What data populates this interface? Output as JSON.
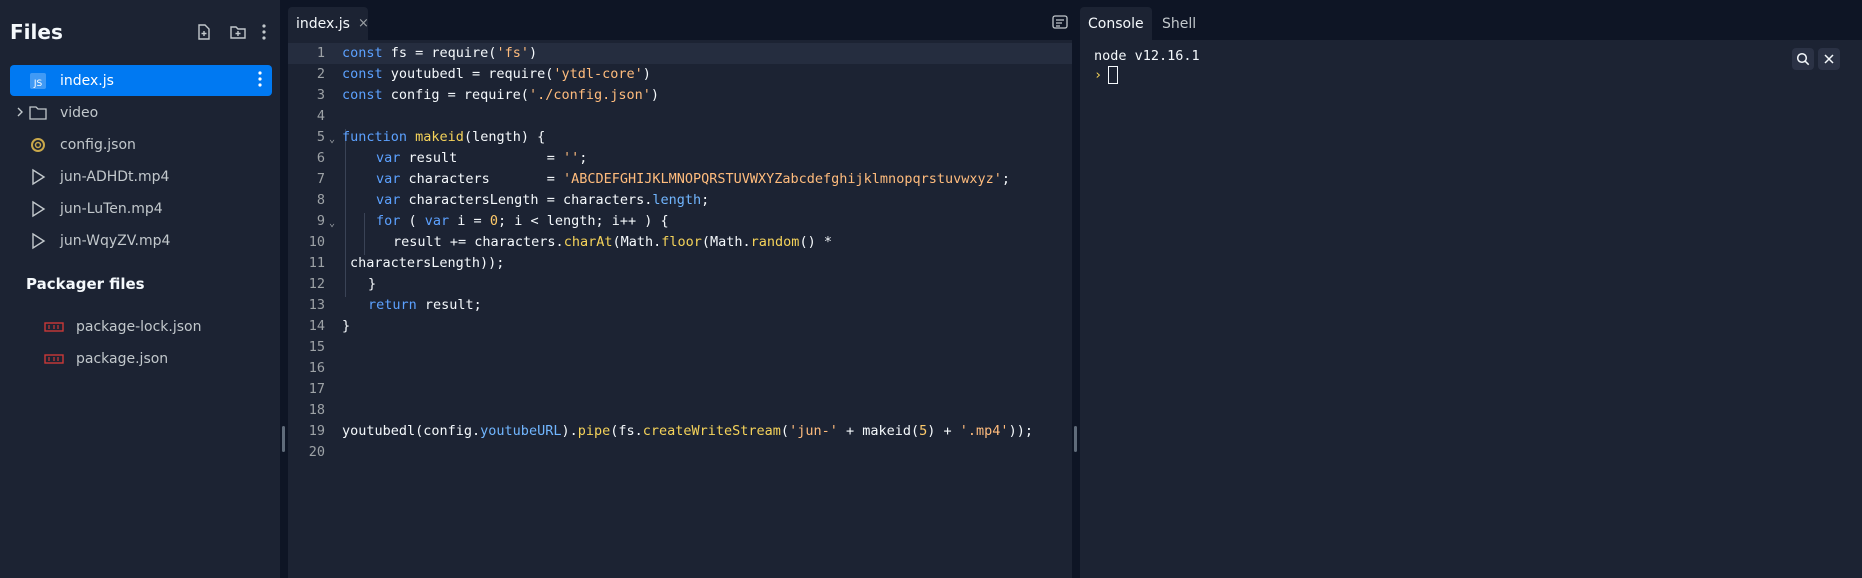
{
  "sidebar": {
    "title": "Files",
    "files": [
      {
        "name": "index.js",
        "icon": "js-file-icon",
        "active": true
      },
      {
        "name": "video",
        "icon": "folder-icon",
        "folder": true
      },
      {
        "name": "config.json",
        "icon": "json-file-icon"
      },
      {
        "name": "jun-ADHDt.mp4",
        "icon": "play-icon"
      },
      {
        "name": "jun-LuTen.mp4",
        "icon": "play-icon"
      },
      {
        "name": "jun-WqyZV.mp4",
        "icon": "play-icon"
      }
    ],
    "packager_title": "Packager files",
    "packager_files": [
      {
        "name": "package-lock.json",
        "icon": "package-icon"
      },
      {
        "name": "package.json",
        "icon": "package-icon"
      }
    ]
  },
  "editor": {
    "tab_label": "index.js",
    "tab_close": "×",
    "lines": [
      "1",
      "2",
      "3",
      "4",
      "5",
      "6",
      "7",
      "8",
      "9",
      "10",
      "11",
      "12",
      "13",
      "14",
      "15",
      "16",
      "17",
      "18",
      "19",
      "20"
    ],
    "code": {
      "l1": [
        "const",
        " fs = require(",
        "'fs'",
        ")"
      ],
      "l2": [
        "const",
        " youtubedl = require(",
        "'ytdl-core'",
        ")"
      ],
      "l3": [
        "const",
        " config = require(",
        "'./config.json'",
        ")"
      ],
      "l5": [
        "function",
        " ",
        "makeid",
        "(length) {"
      ],
      "l6": [
        "var",
        " result           = ",
        "''",
        ";"
      ],
      "l7": [
        "var",
        " characters       = ",
        "'ABCDEFGHIJKLMNOPQRSTUVWXYZabcdefghijklmnopqrstuvwxyz'",
        ";"
      ],
      "l8": [
        "var",
        " charactersLength = characters.",
        "length",
        ";"
      ],
      "l9": [
        "for",
        " ( ",
        "var",
        " i = ",
        "0",
        "; i < length; i++ ) {"
      ],
      "l10": [
        "result += characters.",
        "charAt",
        "(Math.",
        "floor",
        "(Math.",
        "random",
        "() *"
      ],
      "l11": "charactersLength));",
      "l12": "}",
      "l13": [
        "return",
        " result;"
      ],
      "l14": "}",
      "l19": [
        "youtubedl(config.",
        "youtubeURL",
        ").",
        "pipe",
        "(fs.",
        "createWriteStream",
        "(",
        "'jun-'",
        " + makeid(",
        "5",
        ") + ",
        "'.mp4'",
        "));"
      ]
    }
  },
  "console": {
    "tabs": [
      "Console",
      "Shell"
    ],
    "output": "node v12.16.1",
    "prompt": "›"
  }
}
